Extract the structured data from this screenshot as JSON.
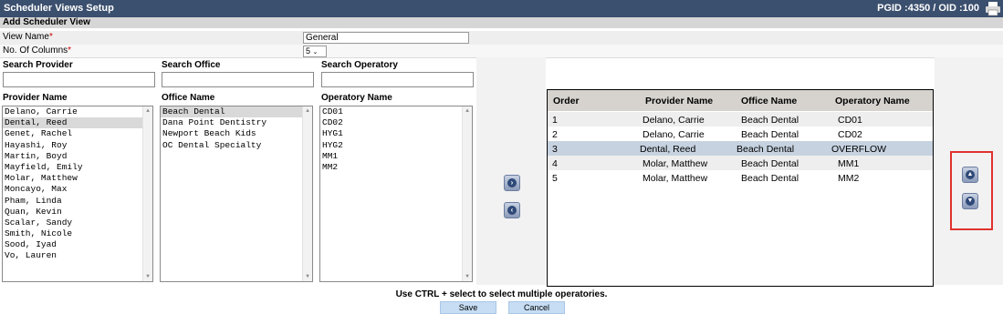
{
  "title": "Scheduler Views Setup",
  "ids": "PGID :4350  /  OID :100",
  "section_title": "Add Scheduler View",
  "form": {
    "view_name_label": "View Name",
    "view_name_value": "General",
    "columns_label": "No. Of Columns",
    "columns_value": "5",
    "required_mark": "*"
  },
  "search": {
    "provider_label": "Search Provider",
    "office_label": "Search Office",
    "operatory_label": "Search Operatory"
  },
  "lists": {
    "provider_header": "Provider Name",
    "office_header": "Office Name",
    "operatory_header": "Operatory Name",
    "providers": [
      "Delano, Carrie",
      "Dental, Reed",
      "Genet, Rachel",
      "Hayashi, Roy",
      "Martin, Boyd",
      "Mayfield, Emily",
      "Molar, Matthew",
      "Moncayo, Max",
      "Pham, Linda",
      "Quan, Kevin",
      "Scalar, Sandy",
      "Smith, Nicole",
      "Sood, Iyad",
      "Vo, Lauren"
    ],
    "offices": [
      "Beach Dental",
      "Dana Point Dentistry",
      "Newport Beach Kids",
      "OC Dental Specialty"
    ],
    "operatories": [
      "CD01",
      "CD02",
      "HYG1",
      "HYG2",
      "MM1",
      "MM2"
    ]
  },
  "grid": {
    "headers": {
      "order": "Order",
      "provider": "Provider Name",
      "office": "Office Name",
      "operatory": "Operatory Name"
    },
    "rows": [
      {
        "order": "1",
        "provider": "Delano, Carrie",
        "office": "Beach Dental",
        "operatory": "CD01"
      },
      {
        "order": "2",
        "provider": "Delano, Carrie",
        "office": "Beach Dental",
        "operatory": "CD02"
      },
      {
        "order": "3",
        "provider": "Dental, Reed",
        "office": "Beach Dental",
        "operatory": "OVERFLOW"
      },
      {
        "order": "4",
        "provider": "Molar, Matthew",
        "office": "Beach Dental",
        "operatory": "MM1"
      },
      {
        "order": "5",
        "provider": "Molar, Matthew",
        "office": "Beach Dental",
        "operatory": "MM2"
      }
    ]
  },
  "hint": "Use CTRL + select to select multiple operatories.",
  "buttons": {
    "save": "Save",
    "cancel": "Cancel"
  },
  "icons": {
    "add": "chevron-right-icon",
    "remove": "chevron-left-icon",
    "up": "chevron-up-icon",
    "down": "chevron-down-icon",
    "print": "printer-icon"
  }
}
